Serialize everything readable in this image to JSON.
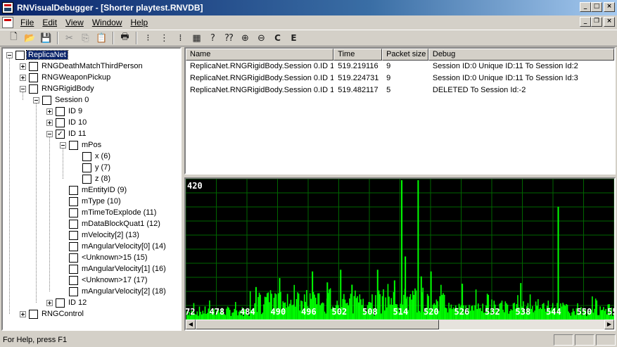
{
  "window": {
    "title": "RNVisualDebugger - [Shorter playtest.RNVDB]"
  },
  "menu": [
    "File",
    "Edit",
    "View",
    "Window",
    "Help"
  ],
  "toolbar": {
    "c_label": "C",
    "e_label": "E"
  },
  "tree": [
    {
      "label": "ReplicaNet",
      "depth": 0,
      "expander": "minus",
      "checked": false,
      "selected": true
    },
    {
      "label": "RNGDeathMatchThirdPerson",
      "depth": 1,
      "expander": "plus",
      "checked": false
    },
    {
      "label": "RNGWeaponPickup",
      "depth": 1,
      "expander": "plus",
      "checked": false
    },
    {
      "label": "RNGRigidBody",
      "depth": 1,
      "expander": "minus",
      "checked": false
    },
    {
      "label": "Session 0",
      "depth": 2,
      "expander": "minus",
      "checked": false
    },
    {
      "label": "ID 9",
      "depth": 3,
      "expander": "plus",
      "checked": false
    },
    {
      "label": "ID 10",
      "depth": 3,
      "expander": "plus",
      "checked": false
    },
    {
      "label": "ID 11",
      "depth": 3,
      "expander": "minus",
      "checked": true
    },
    {
      "label": "mPos",
      "depth": 4,
      "expander": "minus",
      "checked": false
    },
    {
      "label": "x (6)",
      "depth": 5,
      "expander": "none",
      "checked": false
    },
    {
      "label": "y (7)",
      "depth": 5,
      "expander": "none",
      "checked": false
    },
    {
      "label": "z (8)",
      "depth": 5,
      "expander": "none",
      "checked": false
    },
    {
      "label": "mEntityID (9)",
      "depth": 4,
      "expander": "none",
      "checked": false
    },
    {
      "label": "mType (10)",
      "depth": 4,
      "expander": "none",
      "checked": false
    },
    {
      "label": "mTimeToExplode (11)",
      "depth": 4,
      "expander": "none",
      "checked": false
    },
    {
      "label": "mDataBlockQuat1 (12)",
      "depth": 4,
      "expander": "none",
      "checked": false
    },
    {
      "label": "mVelocity[2] (13)",
      "depth": 4,
      "expander": "none",
      "checked": false
    },
    {
      "label": "mAngularVelocity[0] (14)",
      "depth": 4,
      "expander": "none",
      "checked": false
    },
    {
      "label": "<Unknown>15 (15)",
      "depth": 4,
      "expander": "none",
      "checked": false
    },
    {
      "label": "mAngularVelocity[1] (16)",
      "depth": 4,
      "expander": "none",
      "checked": false
    },
    {
      "label": "<Unknown>17 (17)",
      "depth": 4,
      "expander": "none",
      "checked": false
    },
    {
      "label": "mAngularVelocity[2] (18)",
      "depth": 4,
      "expander": "none",
      "checked": false
    },
    {
      "label": "ID 12",
      "depth": 3,
      "expander": "plus",
      "checked": false
    },
    {
      "label": "RNGControl",
      "depth": 1,
      "expander": "plus",
      "checked": false
    }
  ],
  "list": {
    "columns": [
      "Name",
      "Time",
      "Packet size",
      "Debug"
    ],
    "rows": [
      [
        "ReplicaNet.RNGRigidBody.Session 0.ID 11",
        "519.219116",
        "9",
        "Session ID:0   Unique ID:11   To Session Id:2"
      ],
      [
        "ReplicaNet.RNGRigidBody.Session 0.ID 11",
        "519.224731",
        "9",
        "Session ID:0   Unique ID:11   To Session Id:3"
      ],
      [
        "ReplicaNet.RNGRigidBody.Session 0.ID 11",
        "519.482117",
        "5",
        "DELETED    To Session Id:-2"
      ]
    ]
  },
  "chart_data": {
    "type": "bar",
    "ymax_label": "420",
    "ylim": [
      0,
      420
    ],
    "x_ticks": [
      "72",
      "478",
      "484",
      "490",
      "496",
      "502",
      "508",
      "514",
      "520",
      "526",
      "532",
      "538",
      "544",
      "550",
      "55"
    ],
    "xlim": [
      471.5,
      555
    ],
    "colors": {
      "background": "#000000",
      "grid": "#006600",
      "bars": "#00ff00",
      "labels": "#ffffff"
    },
    "spikes": [
      {
        "x": 513.6,
        "value": 420
      },
      {
        "x": 516.8,
        "value": 420
      },
      {
        "x": 544.1,
        "value": 340
      },
      {
        "x": 514.3,
        "value": 190
      },
      {
        "x": 496.2,
        "value": 145
      },
      {
        "x": 501.7,
        "value": 150
      },
      {
        "x": 508.9,
        "value": 150
      },
      {
        "x": 519.3,
        "value": 145
      },
      {
        "x": 517.4,
        "value": 130
      },
      {
        "x": 489.8,
        "value": 125
      },
      {
        "x": 512.2,
        "value": 118
      },
      {
        "x": 536.8,
        "value": 110
      },
      {
        "x": 525.4,
        "value": 108
      },
      {
        "x": 499.1,
        "value": 112
      },
      {
        "x": 485.2,
        "value": 98
      },
      {
        "x": 503.9,
        "value": 105
      }
    ]
  },
  "status": {
    "text": "For Help, press F1"
  }
}
